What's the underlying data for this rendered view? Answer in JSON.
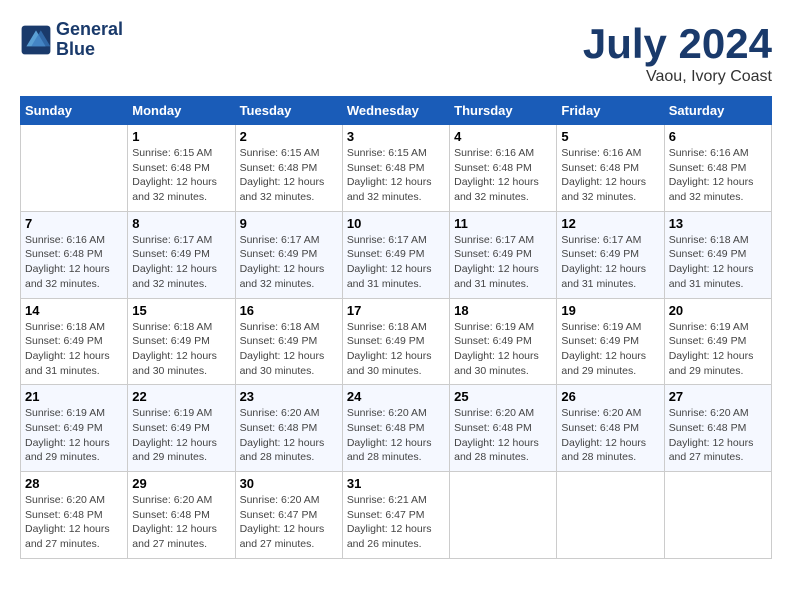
{
  "header": {
    "logo_line1": "General",
    "logo_line2": "Blue",
    "month": "July 2024",
    "location": "Vaou, Ivory Coast"
  },
  "days_of_week": [
    "Sunday",
    "Monday",
    "Tuesday",
    "Wednesday",
    "Thursday",
    "Friday",
    "Saturday"
  ],
  "weeks": [
    [
      {
        "num": "",
        "info": ""
      },
      {
        "num": "1",
        "info": "Sunrise: 6:15 AM\nSunset: 6:48 PM\nDaylight: 12 hours\nand 32 minutes."
      },
      {
        "num": "2",
        "info": "Sunrise: 6:15 AM\nSunset: 6:48 PM\nDaylight: 12 hours\nand 32 minutes."
      },
      {
        "num": "3",
        "info": "Sunrise: 6:15 AM\nSunset: 6:48 PM\nDaylight: 12 hours\nand 32 minutes."
      },
      {
        "num": "4",
        "info": "Sunrise: 6:16 AM\nSunset: 6:48 PM\nDaylight: 12 hours\nand 32 minutes."
      },
      {
        "num": "5",
        "info": "Sunrise: 6:16 AM\nSunset: 6:48 PM\nDaylight: 12 hours\nand 32 minutes."
      },
      {
        "num": "6",
        "info": "Sunrise: 6:16 AM\nSunset: 6:48 PM\nDaylight: 12 hours\nand 32 minutes."
      }
    ],
    [
      {
        "num": "7",
        "info": "Sunrise: 6:16 AM\nSunset: 6:48 PM\nDaylight: 12 hours\nand 32 minutes."
      },
      {
        "num": "8",
        "info": "Sunrise: 6:17 AM\nSunset: 6:49 PM\nDaylight: 12 hours\nand 32 minutes."
      },
      {
        "num": "9",
        "info": "Sunrise: 6:17 AM\nSunset: 6:49 PM\nDaylight: 12 hours\nand 32 minutes."
      },
      {
        "num": "10",
        "info": "Sunrise: 6:17 AM\nSunset: 6:49 PM\nDaylight: 12 hours\nand 31 minutes."
      },
      {
        "num": "11",
        "info": "Sunrise: 6:17 AM\nSunset: 6:49 PM\nDaylight: 12 hours\nand 31 minutes."
      },
      {
        "num": "12",
        "info": "Sunrise: 6:17 AM\nSunset: 6:49 PM\nDaylight: 12 hours\nand 31 minutes."
      },
      {
        "num": "13",
        "info": "Sunrise: 6:18 AM\nSunset: 6:49 PM\nDaylight: 12 hours\nand 31 minutes."
      }
    ],
    [
      {
        "num": "14",
        "info": "Sunrise: 6:18 AM\nSunset: 6:49 PM\nDaylight: 12 hours\nand 31 minutes."
      },
      {
        "num": "15",
        "info": "Sunrise: 6:18 AM\nSunset: 6:49 PM\nDaylight: 12 hours\nand 30 minutes."
      },
      {
        "num": "16",
        "info": "Sunrise: 6:18 AM\nSunset: 6:49 PM\nDaylight: 12 hours\nand 30 minutes."
      },
      {
        "num": "17",
        "info": "Sunrise: 6:18 AM\nSunset: 6:49 PM\nDaylight: 12 hours\nand 30 minutes."
      },
      {
        "num": "18",
        "info": "Sunrise: 6:19 AM\nSunset: 6:49 PM\nDaylight: 12 hours\nand 30 minutes."
      },
      {
        "num": "19",
        "info": "Sunrise: 6:19 AM\nSunset: 6:49 PM\nDaylight: 12 hours\nand 29 minutes."
      },
      {
        "num": "20",
        "info": "Sunrise: 6:19 AM\nSunset: 6:49 PM\nDaylight: 12 hours\nand 29 minutes."
      }
    ],
    [
      {
        "num": "21",
        "info": "Sunrise: 6:19 AM\nSunset: 6:49 PM\nDaylight: 12 hours\nand 29 minutes."
      },
      {
        "num": "22",
        "info": "Sunrise: 6:19 AM\nSunset: 6:49 PM\nDaylight: 12 hours\nand 29 minutes."
      },
      {
        "num": "23",
        "info": "Sunrise: 6:20 AM\nSunset: 6:48 PM\nDaylight: 12 hours\nand 28 minutes."
      },
      {
        "num": "24",
        "info": "Sunrise: 6:20 AM\nSunset: 6:48 PM\nDaylight: 12 hours\nand 28 minutes."
      },
      {
        "num": "25",
        "info": "Sunrise: 6:20 AM\nSunset: 6:48 PM\nDaylight: 12 hours\nand 28 minutes."
      },
      {
        "num": "26",
        "info": "Sunrise: 6:20 AM\nSunset: 6:48 PM\nDaylight: 12 hours\nand 28 minutes."
      },
      {
        "num": "27",
        "info": "Sunrise: 6:20 AM\nSunset: 6:48 PM\nDaylight: 12 hours\nand 27 minutes."
      }
    ],
    [
      {
        "num": "28",
        "info": "Sunrise: 6:20 AM\nSunset: 6:48 PM\nDaylight: 12 hours\nand 27 minutes."
      },
      {
        "num": "29",
        "info": "Sunrise: 6:20 AM\nSunset: 6:48 PM\nDaylight: 12 hours\nand 27 minutes."
      },
      {
        "num": "30",
        "info": "Sunrise: 6:20 AM\nSunset: 6:47 PM\nDaylight: 12 hours\nand 27 minutes."
      },
      {
        "num": "31",
        "info": "Sunrise: 6:21 AM\nSunset: 6:47 PM\nDaylight: 12 hours\nand 26 minutes."
      },
      {
        "num": "",
        "info": ""
      },
      {
        "num": "",
        "info": ""
      },
      {
        "num": "",
        "info": ""
      }
    ]
  ]
}
